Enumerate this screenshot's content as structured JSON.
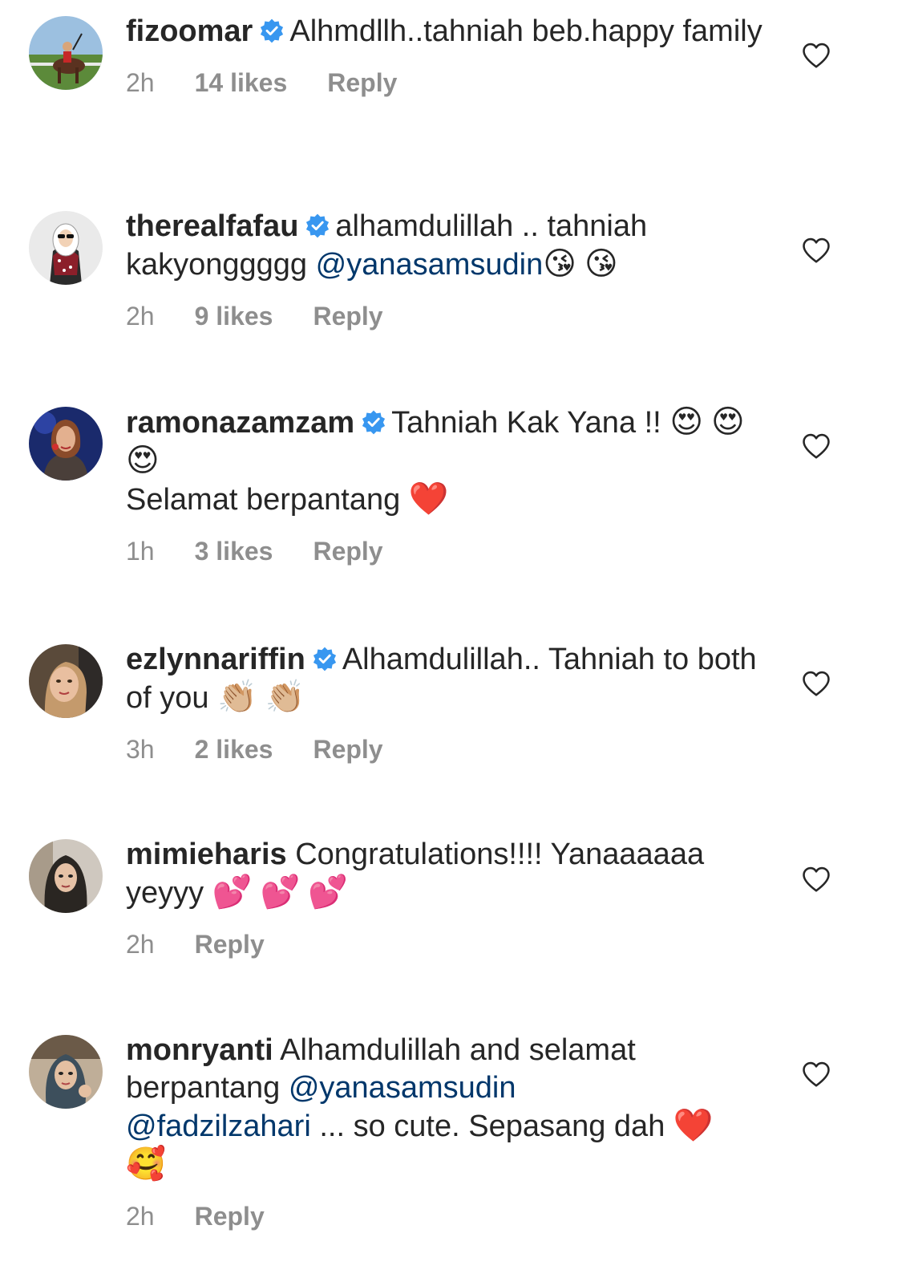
{
  "colors": {
    "text": "#262626",
    "secondary": "#8e8e8e",
    "mention": "#00376b",
    "verified": "#3897f0"
  },
  "comments": [
    {
      "username": "fizoomar",
      "verified": true,
      "avatar_icon": "polo-horse-rider",
      "parts": [
        {
          "text": "Alhmdllh..tahniah beb.happy family"
        }
      ],
      "time": "2h",
      "likes": "14 likes",
      "reply": "Reply"
    },
    {
      "username": "therealfafau",
      "verified": true,
      "avatar_icon": "cartoon-hijab-woman",
      "parts": [
        {
          "text": "alhamdulillah .. tahniah kakyonggggg "
        },
        {
          "mention": "@yanasamsudin"
        },
        {
          "emoji": "😘"
        },
        {
          "emoji": "😘"
        }
      ],
      "time": "2h",
      "likes": "9 likes",
      "reply": "Reply"
    },
    {
      "username": "ramonazamzam",
      "verified": true,
      "avatar_icon": "woman-portrait",
      "parts": [
        {
          "text": "Tahniah Kak Yana !! "
        },
        {
          "emoji": "😍"
        },
        {
          "emoji": "😍"
        },
        {
          "emoji": "😍"
        },
        {
          "break": true
        },
        {
          "text": "Selamat berpantang "
        },
        {
          "emoji": "❤️"
        }
      ],
      "time": "1h",
      "likes": "3 likes",
      "reply": "Reply"
    },
    {
      "username": "ezlynnariffin",
      "verified": true,
      "avatar_icon": "woman-portrait",
      "parts": [
        {
          "text": "Alhamdulillah.. Tahniah to both of you "
        },
        {
          "emoji": "👏🏼"
        },
        {
          "emoji": "👏🏼"
        }
      ],
      "time": "3h",
      "likes": "2 likes",
      "reply": "Reply"
    },
    {
      "username": "mimieharis",
      "verified": false,
      "avatar_icon": "woman-hijab-portrait",
      "parts": [
        {
          "text": "Congratulations!!!! Yanaaaaaa yeyyy "
        },
        {
          "emoji": "💕"
        },
        {
          "emoji": "💕"
        },
        {
          "emoji": "💕"
        }
      ],
      "time": "2h",
      "likes": "",
      "reply": "Reply"
    },
    {
      "username": "monryanti",
      "verified": false,
      "avatar_icon": "woman-hijab-portrait",
      "parts": [
        {
          "text": "Alhamdulillah and selamat berpantang "
        },
        {
          "mention": "@yanasamsudin"
        },
        {
          "break": true
        },
        {
          "mention": "@fadzilzahari"
        },
        {
          "text": " ... so cute. Sepasang dah "
        },
        {
          "emoji": "❤️"
        },
        {
          "emoji": "🥰"
        }
      ],
      "time": "2h",
      "likes": "",
      "reply": "Reply"
    }
  ]
}
